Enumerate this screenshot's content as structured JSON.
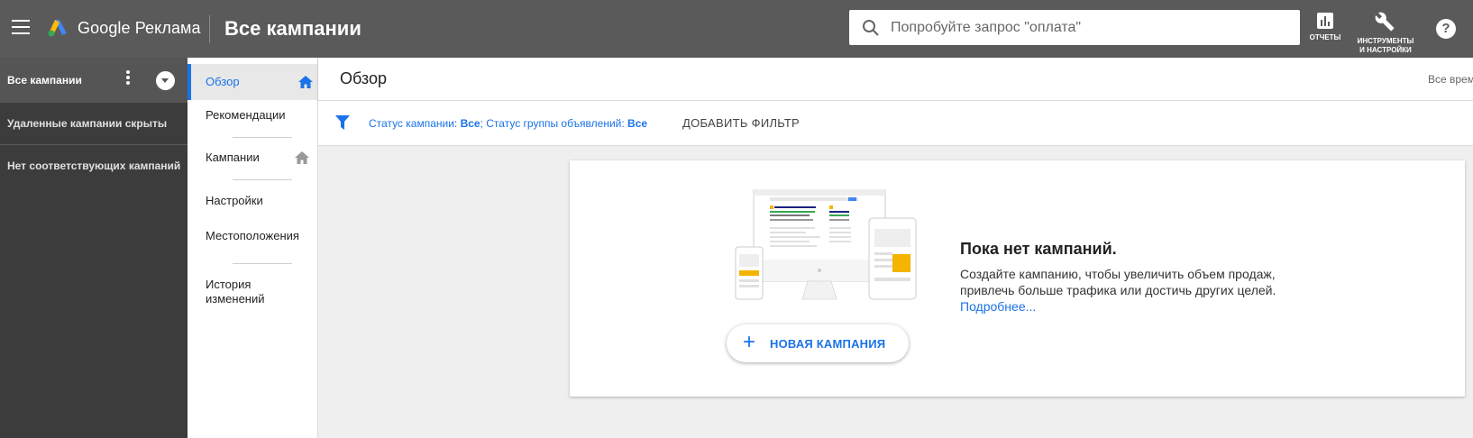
{
  "header": {
    "brand": "Google Реклама",
    "title": "Все кампании",
    "search_placeholder": "Попробуйте запрос \"оплата\"",
    "reports_label": "ОТЧЕТЫ",
    "tools_label_line1": "ИНСТРУМЕНТЫ",
    "tools_label_line2": "И НАСТРОЙКИ",
    "help_label": "?"
  },
  "left_sidebar": {
    "selector_label": "Все кампании",
    "note_removed": "Удаленные кампании скрыты",
    "note_none": "Нет соответствующих кампаний"
  },
  "nav": {
    "items": [
      {
        "label": "Обзор",
        "active": true
      },
      {
        "label": "Рекомендации"
      },
      {
        "label": "Кампании"
      },
      {
        "label": "Настройки"
      },
      {
        "label": "Местоположения"
      },
      {
        "label": "История изменений"
      }
    ]
  },
  "main": {
    "title": "Обзор",
    "date_range": "Все врем",
    "filter": {
      "campaign_status_label": "Статус кампании: ",
      "campaign_status_value": "Все",
      "separator": "; ",
      "adgroup_status_label": "Статус группы объявлений: ",
      "adgroup_status_value": "Все",
      "add_filter": "ДОБАВИТЬ ФИЛЬТР"
    },
    "empty_state": {
      "title": "Пока нет кампаний.",
      "description": "Создайте кампанию, чтобы увеличить объем продаж, привлечь больше трафика или достичь других целей. ",
      "learn_more": "Подробнее...",
      "button_plus": "+",
      "button_label": "НОВАЯ КАМПАНИЯ"
    }
  },
  "colors": {
    "topbar": "#5a5a5a",
    "sidebar": "#3c3c3c",
    "accent_blue": "#1a73e8"
  },
  "icons": [
    "menu-icon",
    "google-ads-logo-icon",
    "search-icon",
    "reports-icon",
    "wrench-icon",
    "help-icon",
    "kebab-icon",
    "dropdown-icon",
    "home-icon",
    "filter-icon",
    "plus-icon"
  ]
}
